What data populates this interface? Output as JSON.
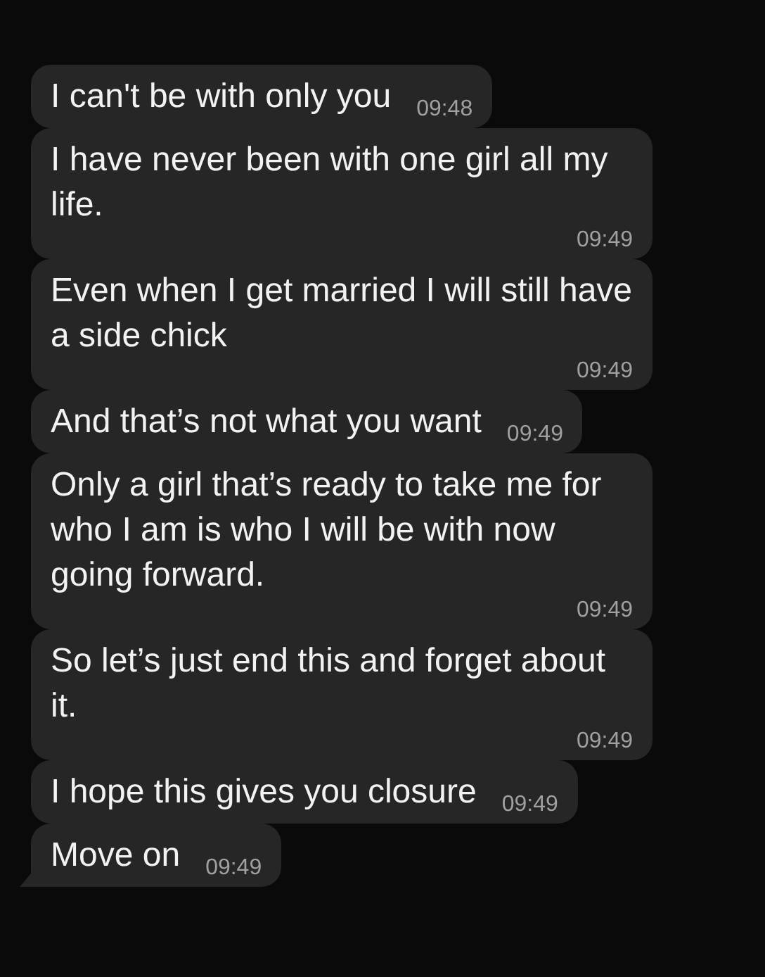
{
  "messages": [
    {
      "text": "I can't be with only you",
      "time": "09:48",
      "tail": false
    },
    {
      "text": "I have never been with one girl all my life.",
      "time": "09:49",
      "tail": false
    },
    {
      "text": "Even when I get married I will still have a side chick",
      "time": "09:49",
      "tail": false
    },
    {
      "text": "And that’s not what you want",
      "time": "09:49",
      "tail": false
    },
    {
      "text": "Only a girl that’s ready to take me for who I am is who I will be with now going forward.",
      "time": "09:49",
      "tail": false
    },
    {
      "text": "So let’s just end this and forget about it.",
      "time": "09:49",
      "tail": false
    },
    {
      "text": "I hope this gives you closure",
      "time": "09:49",
      "tail": false
    },
    {
      "text": "Move on",
      "time": "09:49",
      "tail": true
    }
  ]
}
